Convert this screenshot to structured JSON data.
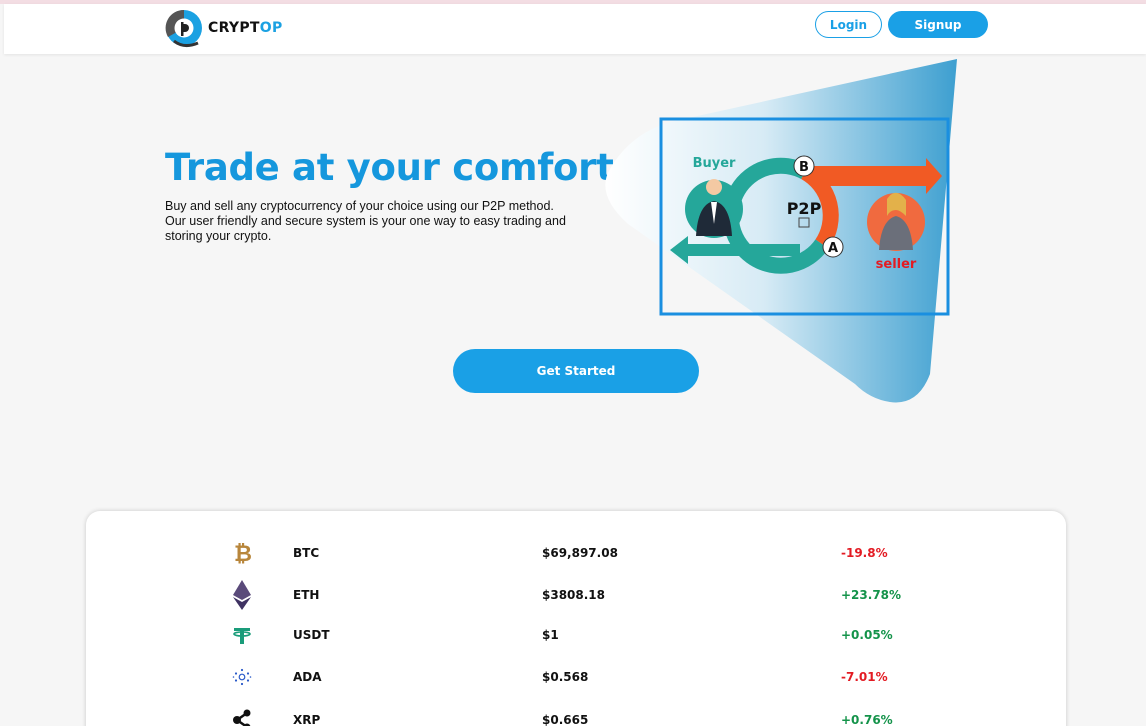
{
  "brand": {
    "name_prefix": "CRYPT",
    "name_accent": "OP"
  },
  "nav": {
    "login_label": "Login",
    "signup_label": "Signup"
  },
  "hero": {
    "title": "Trade at your comfort",
    "description": "Buy and sell any cryptocurrency of your choice using our P2P method. Our user friendly and secure system is your one way to easy trading and storing your crypto.",
    "cta_label": "Get Started",
    "illustration": {
      "buyer_label": "Buyer",
      "seller_label": "seller",
      "center_label": "P2P",
      "marker_b": "B",
      "marker_a": "A"
    }
  },
  "coins": [
    {
      "icon": "bitcoin-icon",
      "symbol": "BTC",
      "price": "$69,897.08",
      "change": "-19.8%",
      "trend": "down"
    },
    {
      "icon": "ethereum-icon",
      "symbol": "ETH",
      "price": "$3808.18",
      "change": "+23.78%",
      "trend": "up"
    },
    {
      "icon": "tether-icon",
      "symbol": "USDT",
      "price": "$1",
      "change": "+0.05%",
      "trend": "up"
    },
    {
      "icon": "cardano-icon",
      "symbol": "ADA",
      "price": "$0.568",
      "change": "-7.01%",
      "trend": "down"
    },
    {
      "icon": "ripple-icon",
      "symbol": "XRP",
      "price": "$0.665",
      "change": "+0.76%",
      "trend": "up"
    }
  ],
  "colors": {
    "accent": "#1aa0e6",
    "positive": "#14934a",
    "negative": "#e31b23"
  }
}
